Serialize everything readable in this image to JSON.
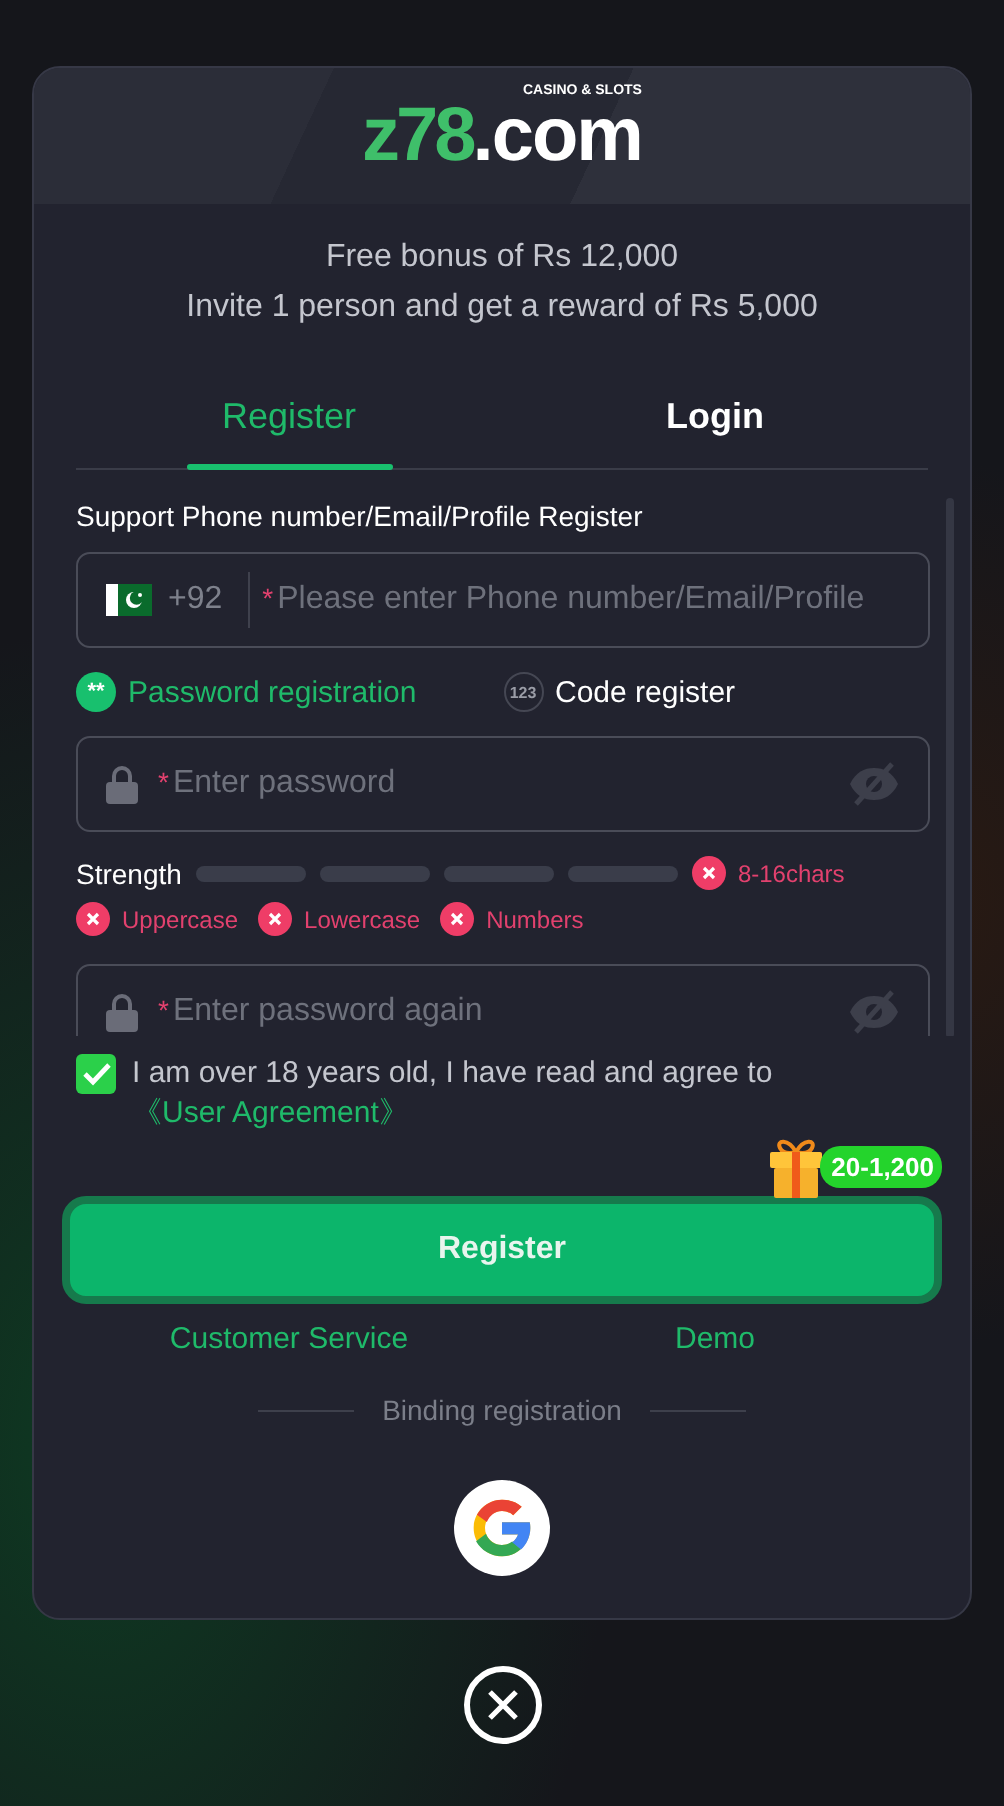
{
  "logo": {
    "brand": "z78",
    "domain": ".com",
    "tagline": "CASINO & SLOTS"
  },
  "promo": [
    "Free bonus of Rs 12,000",
    "Invite 1 person and get a reward of Rs 5,000"
  ],
  "tabs": [
    {
      "label": "Register",
      "selected": true
    },
    {
      "label": "Login",
      "selected": false
    }
  ],
  "form_label": "Support Phone number/Email/Profile Register",
  "account_field": {
    "country_code": "+92",
    "required_mark": "*",
    "placeholder": "Please enter Phone number/Email/Profile"
  },
  "methods": [
    {
      "label": "Password registration",
      "badge": "**",
      "selected": true
    },
    {
      "label": "Code register",
      "badge": "123",
      "selected": false
    }
  ],
  "password_field": {
    "required_mark": "*",
    "placeholder": "Enter password"
  },
  "strength": {
    "label": "Strength"
  },
  "rules": [
    {
      "label": "8-16chars",
      "met": false
    },
    {
      "label": "Uppercase",
      "met": false
    },
    {
      "label": "Lowercase",
      "met": false
    },
    {
      "label": "Numbers",
      "met": false
    }
  ],
  "confirm_field": {
    "required_mark": "*",
    "placeholder": "Enter password again"
  },
  "agreement": {
    "checked": true,
    "text": "I am over 18 years old, I have read and agree to",
    "link": "《User Agreement》"
  },
  "reward_badge": "20-1,200",
  "submit": "Register",
  "links": [
    "Customer Service",
    "Demo"
  ],
  "binding": "Binding registration"
}
